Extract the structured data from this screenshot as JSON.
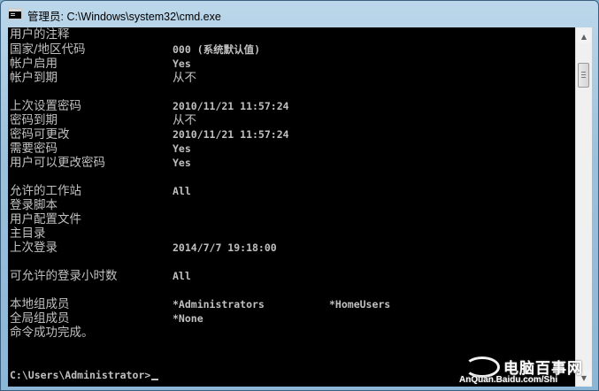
{
  "window": {
    "title": "管理员: C:\\Windows\\system32\\cmd.exe",
    "icon": "cmd-icon"
  },
  "console": {
    "lines": [
      {
        "label": "用户的注释",
        "value": ""
      },
      {
        "label": "国家/地区代码",
        "value": "000 (系统默认值)"
      },
      {
        "label": "帐户启用",
        "value": "Yes"
      },
      {
        "label": "帐户到期",
        "value": "从不"
      },
      {
        "label": "上次设置密码",
        "value": "2010/11/21 11:57:24"
      },
      {
        "label": "密码到期",
        "value": "从不"
      },
      {
        "label": "密码可更改",
        "value": "2010/11/21 11:57:24"
      },
      {
        "label": "需要密码",
        "value": "Yes"
      },
      {
        "label": "用户可以更改密码",
        "value": "Yes"
      },
      {
        "label": "允许的工作站",
        "value": "All"
      },
      {
        "label": "登录脚本",
        "value": ""
      },
      {
        "label": "用户配置文件",
        "value": ""
      },
      {
        "label": "主目录",
        "value": ""
      },
      {
        "label": "上次登录",
        "value": "2014/7/7 19:18:00"
      },
      {
        "label": "可允许的登录小时数",
        "value": "All"
      },
      {
        "label": "本地组成员",
        "value": "*Administrators",
        "value2": "*HomeUsers"
      },
      {
        "label": "全局组成员",
        "value": "*None"
      }
    ],
    "completion": "命令成功完成。",
    "prompt": "C:\\Users\\Administrator>"
  },
  "watermark": {
    "brand": "电脑百事网",
    "url": "AnQuan.Baidu.com/Shi"
  }
}
